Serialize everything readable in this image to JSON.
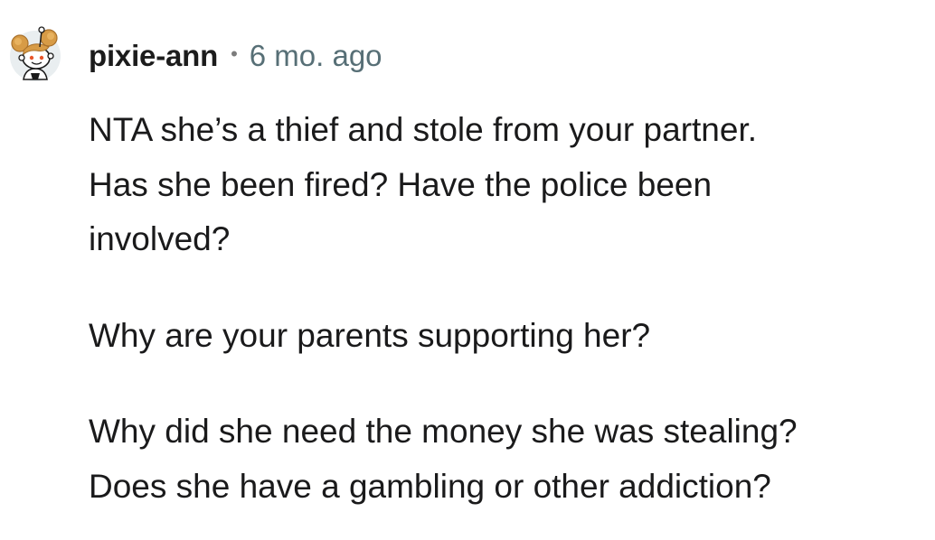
{
  "comment": {
    "username": "pixie-ann",
    "separator": "•",
    "timestamp": "6 mo. ago",
    "paragraphs": [
      {
        "lines": [
          "NTA she’s a thief and stole from your partner.",
          "Has she been fired? Have the police been",
          "involved?"
        ]
      },
      {
        "lines": [
          "Why are your parents supporting her?"
        ]
      },
      {
        "lines": [
          "Why did she need the money she was stealing?",
          "Does she have a gambling or other addiction?"
        ]
      }
    ]
  },
  "avatar": {
    "icon": "snoo-avatar-icon",
    "colors": {
      "hair": "#d79b46",
      "hair_shade": "#a8702b",
      "face": "#ffffff",
      "outline": "#1a1a1a",
      "background": "#e9eef0"
    }
  }
}
